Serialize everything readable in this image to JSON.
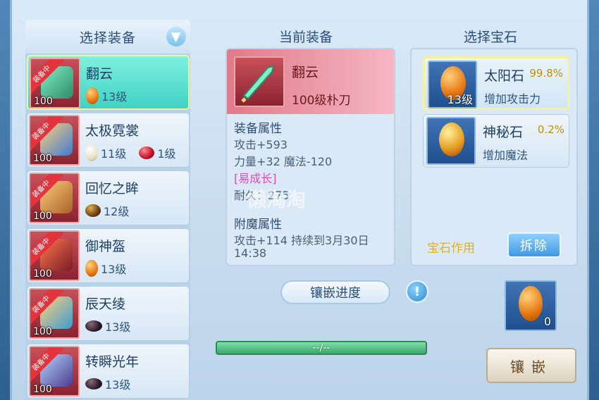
{
  "left": {
    "title": "选择装备",
    "items": [
      {
        "name": "翻云",
        "level": "100",
        "badge": "装备中",
        "gems": [
          {
            "type": "orange",
            "text": "13级"
          }
        ],
        "selected": true
      },
      {
        "name": "太极霓裳",
        "level": "100",
        "badge": "装备中",
        "gems": [
          {
            "type": "white",
            "text": "11级"
          },
          {
            "type": "red",
            "text": "1级"
          }
        ],
        "selected": false
      },
      {
        "name": "回忆之眸",
        "level": "100",
        "badge": "装备中",
        "gems": [
          {
            "type": "brown",
            "text": "12级"
          }
        ],
        "selected": false
      },
      {
        "name": "御神盔",
        "level": "100",
        "badge": "装备中",
        "gems": [
          {
            "type": "orange",
            "text": "13级"
          }
        ],
        "selected": false
      },
      {
        "name": "辰天绫",
        "level": "100",
        "badge": "装备中",
        "gems": [
          {
            "type": "dark",
            "text": "13级"
          }
        ],
        "selected": false
      },
      {
        "name": "转瞬光年",
        "level": "100",
        "badge": "装备中",
        "gems": [
          {
            "type": "dark",
            "text": "13级"
          }
        ],
        "selected": false
      }
    ]
  },
  "middle": {
    "title": "当前装备",
    "equip_name": "翻云",
    "equip_sub": "100级朴刀",
    "attr_head": "装备属性",
    "attr_lines": [
      "攻击+593",
      "力量+32 魔法-120"
    ],
    "tag": "[易成长]",
    "durability": "耐久：275",
    "magic_head": "附魔属性",
    "magic_lines": [
      "攻击+114 持续到3月30日",
      "14:38"
    ],
    "watermark": "懒淘淘",
    "progress_label": "镶嵌进度",
    "progress_text": "--/--",
    "info_icon": "!"
  },
  "right": {
    "title": "选择宝石",
    "gems": [
      {
        "name": "太阳石",
        "pct": "99.8%",
        "desc": "增加攻击力",
        "count": "13级",
        "type": "orange",
        "selected": true
      },
      {
        "name": "神秘石",
        "pct": "0.2%",
        "desc": "增加魔法",
        "count": "",
        "type": "gold",
        "selected": false
      }
    ],
    "use_label": "宝石作用",
    "remove_label": "拆除",
    "slot_count": "0",
    "inlay_label": "镶嵌"
  },
  "colors": {
    "accent": "#3fd2c2",
    "selected_border": "#f6f29a"
  }
}
